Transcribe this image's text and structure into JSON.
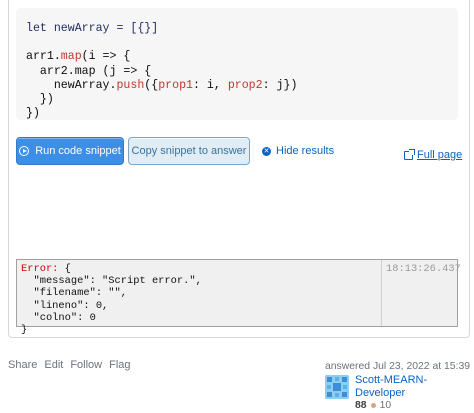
{
  "code": {
    "lines": [
      [
        {
          "t": "let newArray = [{}]",
          "c": "kw"
        }
      ],
      [
        {
          "t": "",
          "c": ""
        }
      ],
      [
        {
          "t": "arr1.",
          "c": ""
        },
        {
          "t": "map",
          "c": "fn"
        },
        {
          "t": "(i => {",
          "c": ""
        }
      ],
      [
        {
          "t": "  arr2.map (j => {",
          "c": ""
        }
      ],
      [
        {
          "t": "    newArray.",
          "c": ""
        },
        {
          "t": "push",
          "c": "fn"
        },
        {
          "t": "({",
          "c": ""
        },
        {
          "t": "prop1",
          "c": "prop"
        },
        {
          "t": ": i, ",
          "c": ""
        },
        {
          "t": "prop2",
          "c": "prop"
        },
        {
          "t": ": j})",
          "c": ""
        }
      ],
      [
        {
          "t": "  })",
          "c": ""
        }
      ],
      [
        {
          "t": "})",
          "c": ""
        }
      ]
    ]
  },
  "toolbar": {
    "run_label": "Run code snippet",
    "copy_label": "Copy snippet to answer",
    "hide_label": "Hide results",
    "full_page_label": "Full page"
  },
  "console": {
    "error_label": "Error:",
    "lines": [
      " {",
      "  \"message\": \"Script error.\",",
      "  \"filename\": \"\",",
      "  \"lineno\": 0,",
      "  \"colno\": 0",
      "}"
    ],
    "timestamp": "18:13:26.437"
  },
  "post_menu": [
    "Share",
    "Edit",
    "Follow",
    "Flag"
  ],
  "user_card": {
    "answered": "answered Jul 23, 2022 at 15:39",
    "user_name": "Scott-MEARN-Developer",
    "reputation": "88",
    "bronze_badges": "10"
  },
  "colors": {
    "accent": "#3c8fe6",
    "link": "#0a63c2",
    "error": "#d50000"
  }
}
